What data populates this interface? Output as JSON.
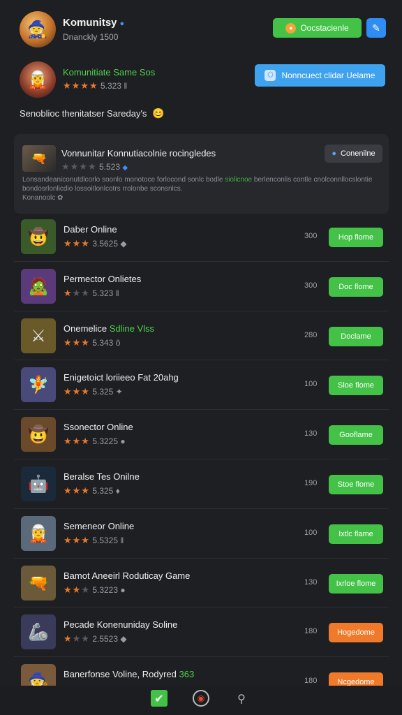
{
  "header": {
    "title": "Komunitsy",
    "subtitle": "Dnanckly 1500",
    "avatar_icon": "🧙",
    "verified_icon": "●",
    "green_button_label": "Oocstacienle",
    "edit_icon": "✎"
  },
  "featured": {
    "avatar_icon": "🧝",
    "name": "Komunitiate Same Sos",
    "rating": "5.323",
    "button_icon": "⬡",
    "button_label": "Nonncuect clidar Uelame"
  },
  "status": {
    "text": "Senoblioc thenitatser Sareday's",
    "emoji": "😊"
  },
  "card": {
    "thumb_icon": "🔫",
    "title": "Vonnunitar Konnutiacolnie rocingledes",
    "rating": "5.523",
    "button_icon": "●",
    "button_label": "Conenilne",
    "desc_part1": "Lonsandeaniconutdlcorlo soonlo monotoce forlocond sonlc bodle  ",
    "desc_highlight": "siolicnoe",
    "desc_part2": " berlenconlis contle cnolconnllocslontie bondosrlonlicdio lossoitlonlcotrs rrolonbe sconsnlcs.",
    "footer": "Konanoolc"
  },
  "games": [
    {
      "icon": "🤠",
      "bg": "#3a5a2a",
      "name": "Daber Online",
      "name_hl": "",
      "stars": 3,
      "rating": "3.5625",
      "badge": "◆",
      "count": "300",
      "button": "Hop flome",
      "btn_color": "green"
    },
    {
      "icon": "🧟",
      "bg": "#5a3a7a",
      "name": "Permector Onlietes",
      "name_hl": "",
      "stars": 1,
      "rating": "5.323",
      "badge": "ǁ",
      "count": "300",
      "button": "Doc flome",
      "btn_color": "green"
    },
    {
      "icon": "⚔",
      "bg": "#6a5a2a",
      "name": "Onemelice ",
      "name_hl": "Sdline Vlss",
      "stars": 3,
      "rating": "5.343",
      "badge": "ô",
      "count": "280",
      "button": "Doclame",
      "btn_color": "green"
    },
    {
      "icon": "🧚",
      "bg": "#4a4a7a",
      "name": "Enigetoict loriieeo Fat 20ahg",
      "name_hl": "",
      "stars": 3,
      "rating": "5.325",
      "badge": "✦",
      "count": "100",
      "button": "Sloe flome",
      "btn_color": "green"
    },
    {
      "icon": "🤠",
      "bg": "#6a4a2a",
      "name": "Ssonector Online",
      "name_hl": "",
      "stars": 3,
      "rating": "5.3225",
      "badge": "●",
      "count": "130",
      "button": "Gooflame",
      "btn_color": "green"
    },
    {
      "icon": "🤖",
      "bg": "#1a2a3a",
      "name": "Beralse Tes Onilne",
      "name_hl": "",
      "stars": 3,
      "rating": "5.325",
      "badge": "♦",
      "count": "190",
      "button": "Stoe flome",
      "btn_color": "green"
    },
    {
      "icon": "🧝",
      "bg": "#5a6a7a",
      "name": "Semeneor Online",
      "name_hl": "",
      "stars": 3,
      "rating": "5.5325",
      "badge": "ǁ",
      "count": "100",
      "button": "Ixtlc flame",
      "btn_color": "green"
    },
    {
      "icon": "🔫",
      "bg": "#6a5a3a",
      "name": "Bamot Aneeirl Roduticay Game",
      "name_hl": "",
      "stars": 2,
      "rating": "5.3223",
      "badge": "●",
      "count": "130",
      "button": "Ixrloe flome",
      "btn_color": "green"
    },
    {
      "icon": "🦾",
      "bg": "#3a3a5a",
      "name": "Pecade Konenuniday Soline",
      "name_hl": "",
      "stars": 1,
      "rating": "2.5523",
      "badge": "◆",
      "count": "180",
      "button": "Hogedome",
      "btn_color": "orange"
    },
    {
      "icon": "🧙",
      "bg": "#7a5a3a",
      "name": "Banerfonse Voline, Rodyred ",
      "name_hl": "363",
      "stars": 3,
      "rating": "",
      "badge": "",
      "count": "180",
      "button": "Ncgedome",
      "btn_color": "orange"
    }
  ],
  "bottom_nav": {
    "home_icon": "✔",
    "game_icon": "◉",
    "profile_icon": "⚲"
  },
  "colors": {
    "background": "#1e1f22",
    "green": "#43c247",
    "orange": "#f07a2a",
    "blue": "#3fa2ee",
    "star": "#e8782a"
  }
}
